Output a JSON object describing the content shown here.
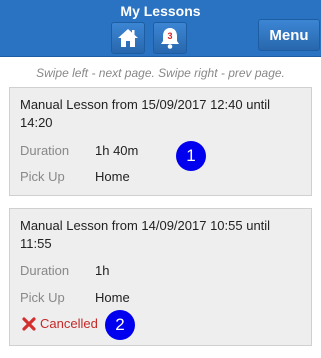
{
  "header": {
    "title": "My Lessons",
    "menu_label": "Menu",
    "notification_count": "3",
    "icons": [
      "home-icon",
      "bell-icon"
    ]
  },
  "hint": "Swipe left - next page. Swipe right - prev page.",
  "lessons": [
    {
      "title": "Manual Lesson from 15/09/2017 12:40 until 14:20",
      "duration_label": "Duration",
      "duration": "1h 40m",
      "pickup_label": "Pick Up",
      "pickup": "Home",
      "badge": "1"
    },
    {
      "title": "Manual Lesson from 14/09/2017 10:55 until 11:55",
      "duration_label": "Duration",
      "duration": "1h",
      "pickup_label": "Pick Up",
      "pickup": "Home",
      "status": "Cancelled",
      "status_icon": "cross-icon",
      "badge": "2"
    }
  ],
  "colors": {
    "header": "#2a73c2",
    "badge": "#0000ee",
    "cancelled": "#c62828"
  }
}
